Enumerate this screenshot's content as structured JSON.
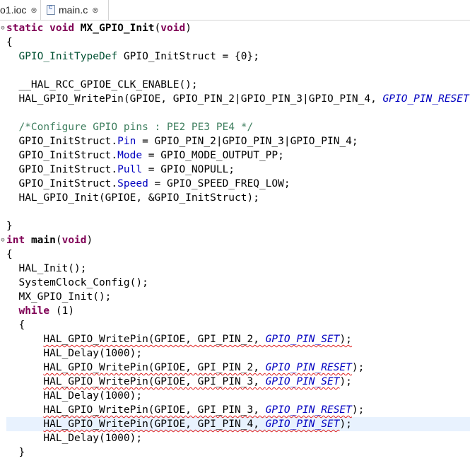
{
  "tabs": [
    {
      "label": "o1.ioc",
      "close": "⊗"
    },
    {
      "label": "main.c",
      "close": "⊗"
    }
  ],
  "code": {
    "l01": {
      "kw1": "static",
      "kw2": "void",
      "fn": "MX_GPIO_Init",
      "p1": "(",
      "kw3": "void",
      "p2": ")"
    },
    "l02": "{",
    "l03": {
      "type": "GPIO_InitTypeDef",
      "rest": " GPIO_InitStruct = {0};"
    },
    "l05": "__HAL_RCC_GPIOE_CLK_ENABLE();",
    "l06": {
      "text": "HAL_GPIO_WritePin(GPIOE, GPIO_PIN_2|GPIO_PIN_3|GPIO_PIN_4, ",
      "macro": "GPIO_PIN_RESET);"
    },
    "l08": "/*Configure GPIO pins : PE2 PE3 PE4 */",
    "l09": {
      "a": "GPIO_InitStruct.",
      "field": "Pin",
      "b": " = GPIO_PIN_2|GPIO_PIN_3|GPIO_PIN_4;"
    },
    "l10": {
      "a": "GPIO_InitStruct.",
      "field": "Mode",
      "b": " = GPIO_MODE_OUTPUT_PP;"
    },
    "l11": {
      "a": "GPIO_InitStruct.",
      "field": "Pull",
      "b": " = GPIO_NOPULL;"
    },
    "l12": {
      "a": "GPIO_InitStruct.",
      "field": "Speed",
      "b": " = GPIO_SPEED_FREQ_LOW;"
    },
    "l13": "HAL_GPIO_Init(GPIOE, &GPIO_InitStruct);",
    "l15": "}",
    "l16": {
      "kw1": "int",
      "fn": "main",
      "p1": "(",
      "kw2": "void",
      "p2": ")"
    },
    "l17": "{",
    "l18": "HAL_Init();",
    "l19": "SystemClock_Config();",
    "l20": "MX_GPIO_Init();",
    "l21": {
      "kw": "while",
      "rest": " (1)"
    },
    "l22": "{",
    "l23": {
      "text": "HAL_GPIO_WritePin(GPIOE, GPI_PIN_2, ",
      "macro": "GPIO_PIN_SET",
      "end": ");"
    },
    "l24": "HAL_Delay(1000);",
    "l25": {
      "text": "HAL_GPIO_WritePin(GPIOE, GPI_PIN_2, ",
      "macro": "GPIO_PIN_RESET",
      "end": ");"
    },
    "l26": {
      "text": "HAL_GPIO_WritePin(GPIOE, GPI_PIN_3, ",
      "macro": "GPIO_PIN_SET",
      "end": ");"
    },
    "l27": "HAL_Delay(1000);",
    "l28": {
      "text": "HAL_GPIO_WritePin(GPIOE, GPI_PIN_3, ",
      "macro": "GPIO_PIN_RESET",
      "end": ");"
    },
    "l29": {
      "text": "HAL_GPIO_WritePin(GPIOE, GPI_PIN_4, ",
      "macro": "GPIO_PIN_SET",
      "end": ");"
    },
    "l30": "HAL_Delay(1000);",
    "l31": "}"
  },
  "fold_marker": "⊖",
  "colors": {
    "keyword": "#7f0055",
    "comment": "#3f7f5f",
    "field": "#0000c0",
    "type": "#005032",
    "error_underline": "#e02020",
    "current_line": "#e8f2fe"
  }
}
